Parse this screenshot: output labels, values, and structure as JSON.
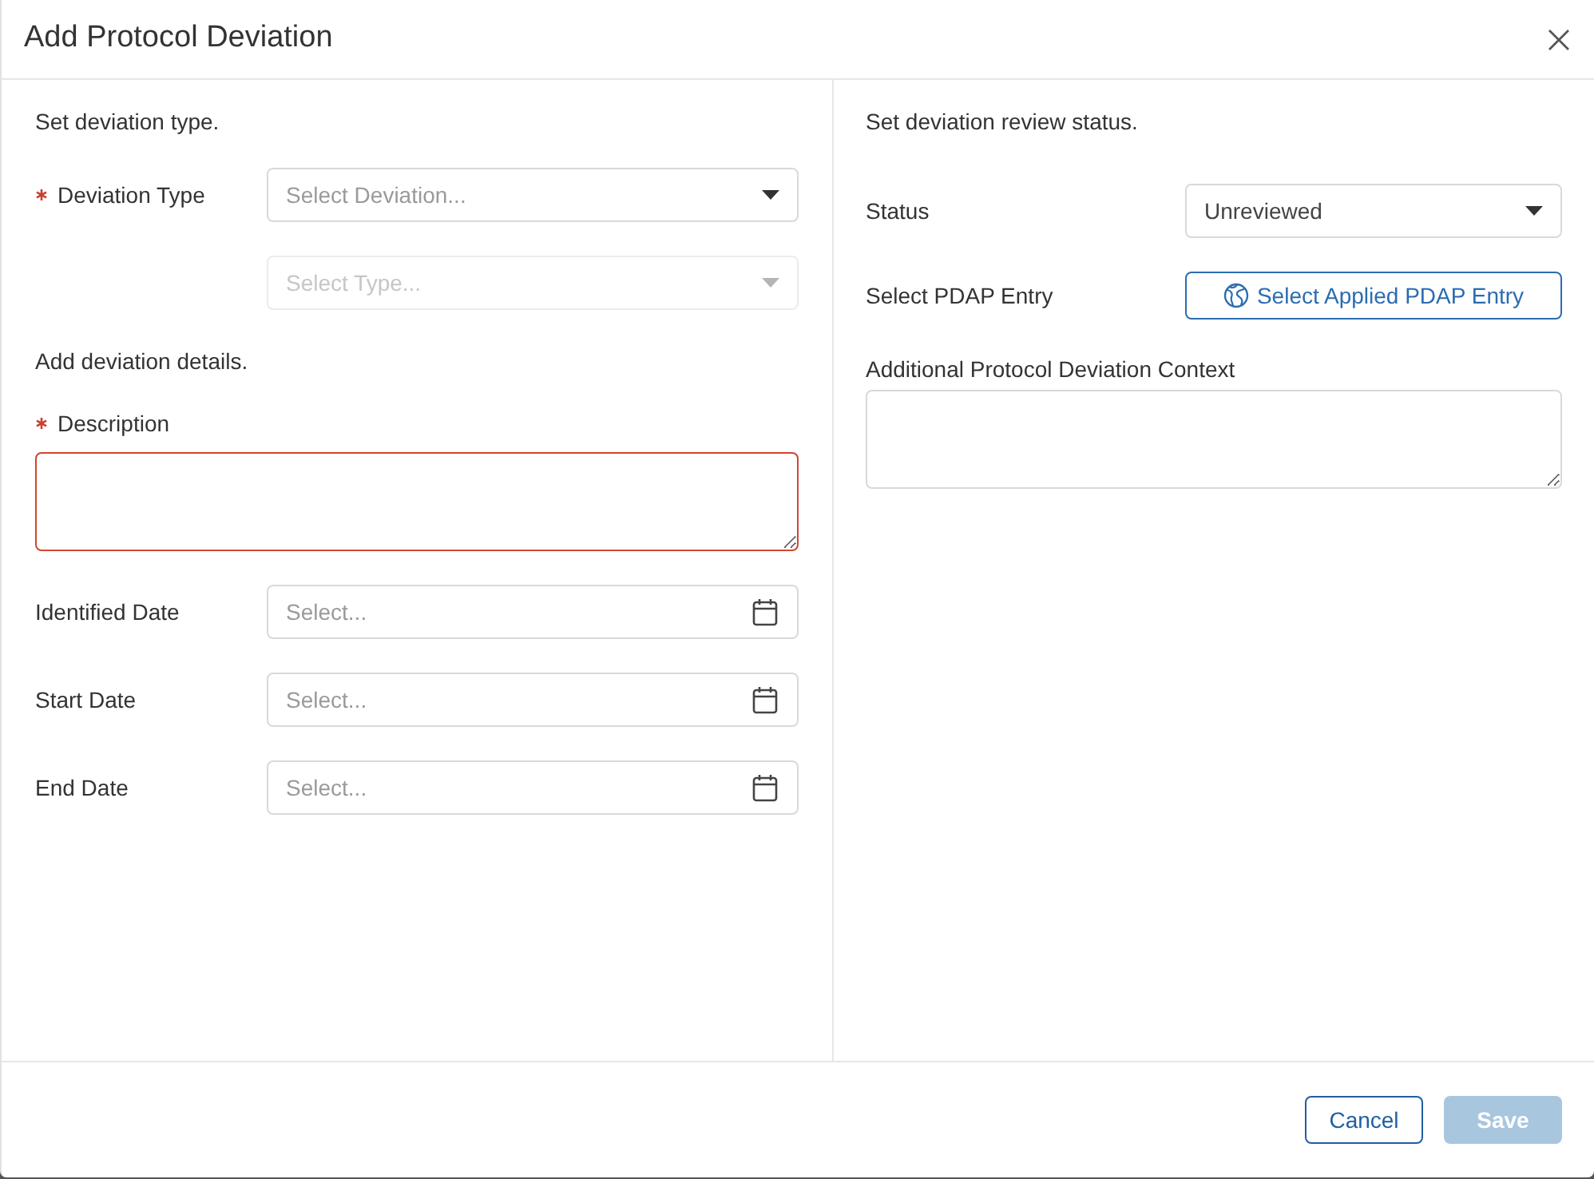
{
  "dialog": {
    "title": "Add Protocol Deviation"
  },
  "panels": [
    {
      "sections": [
        {
          "heading": "Set deviation type.",
          "fields": [
            {
              "kind": "select",
              "label": "Deviation Type",
              "required": true,
              "placeholder": "Select Deviation...",
              "disabled": false
            },
            {
              "kind": "select",
              "placeholder": "Select Type...",
              "disabled": true
            }
          ]
        },
        {
          "heading": "Add deviation details.",
          "fields": [
            {
              "kind": "textarea",
              "label": "Description",
              "required": true,
              "invalid": true
            },
            {
              "kind": "date",
              "label": "Identified Date",
              "required": false,
              "placeholder": "Select..."
            },
            {
              "kind": "date",
              "label": "Start Date",
              "required": false,
              "placeholder": "Select..."
            },
            {
              "kind": "date",
              "label": "End Date",
              "required": false,
              "placeholder": "Select..."
            }
          ]
        }
      ]
    },
    {
      "sections": [
        {
          "heading": "Set deviation review status.",
          "fields": [
            {
              "kind": "select",
              "label": "Status",
              "required": false,
              "value": "Unreviewed",
              "disabled": false
            },
            {
              "kind": "picker_button",
              "label": "Select PDAP Entry",
              "required": false,
              "button_label": "Select Applied PDAP Entry"
            },
            {
              "kind": "textarea",
              "label": "Additional Protocol Deviation Context",
              "required": false,
              "invalid": false
            }
          ]
        }
      ]
    }
  ],
  "footer": {
    "buttons": [
      {
        "label": "Cancel",
        "kind": "secondary",
        "disabled": false
      },
      {
        "label": "Save",
        "kind": "primary",
        "disabled": true
      }
    ]
  }
}
